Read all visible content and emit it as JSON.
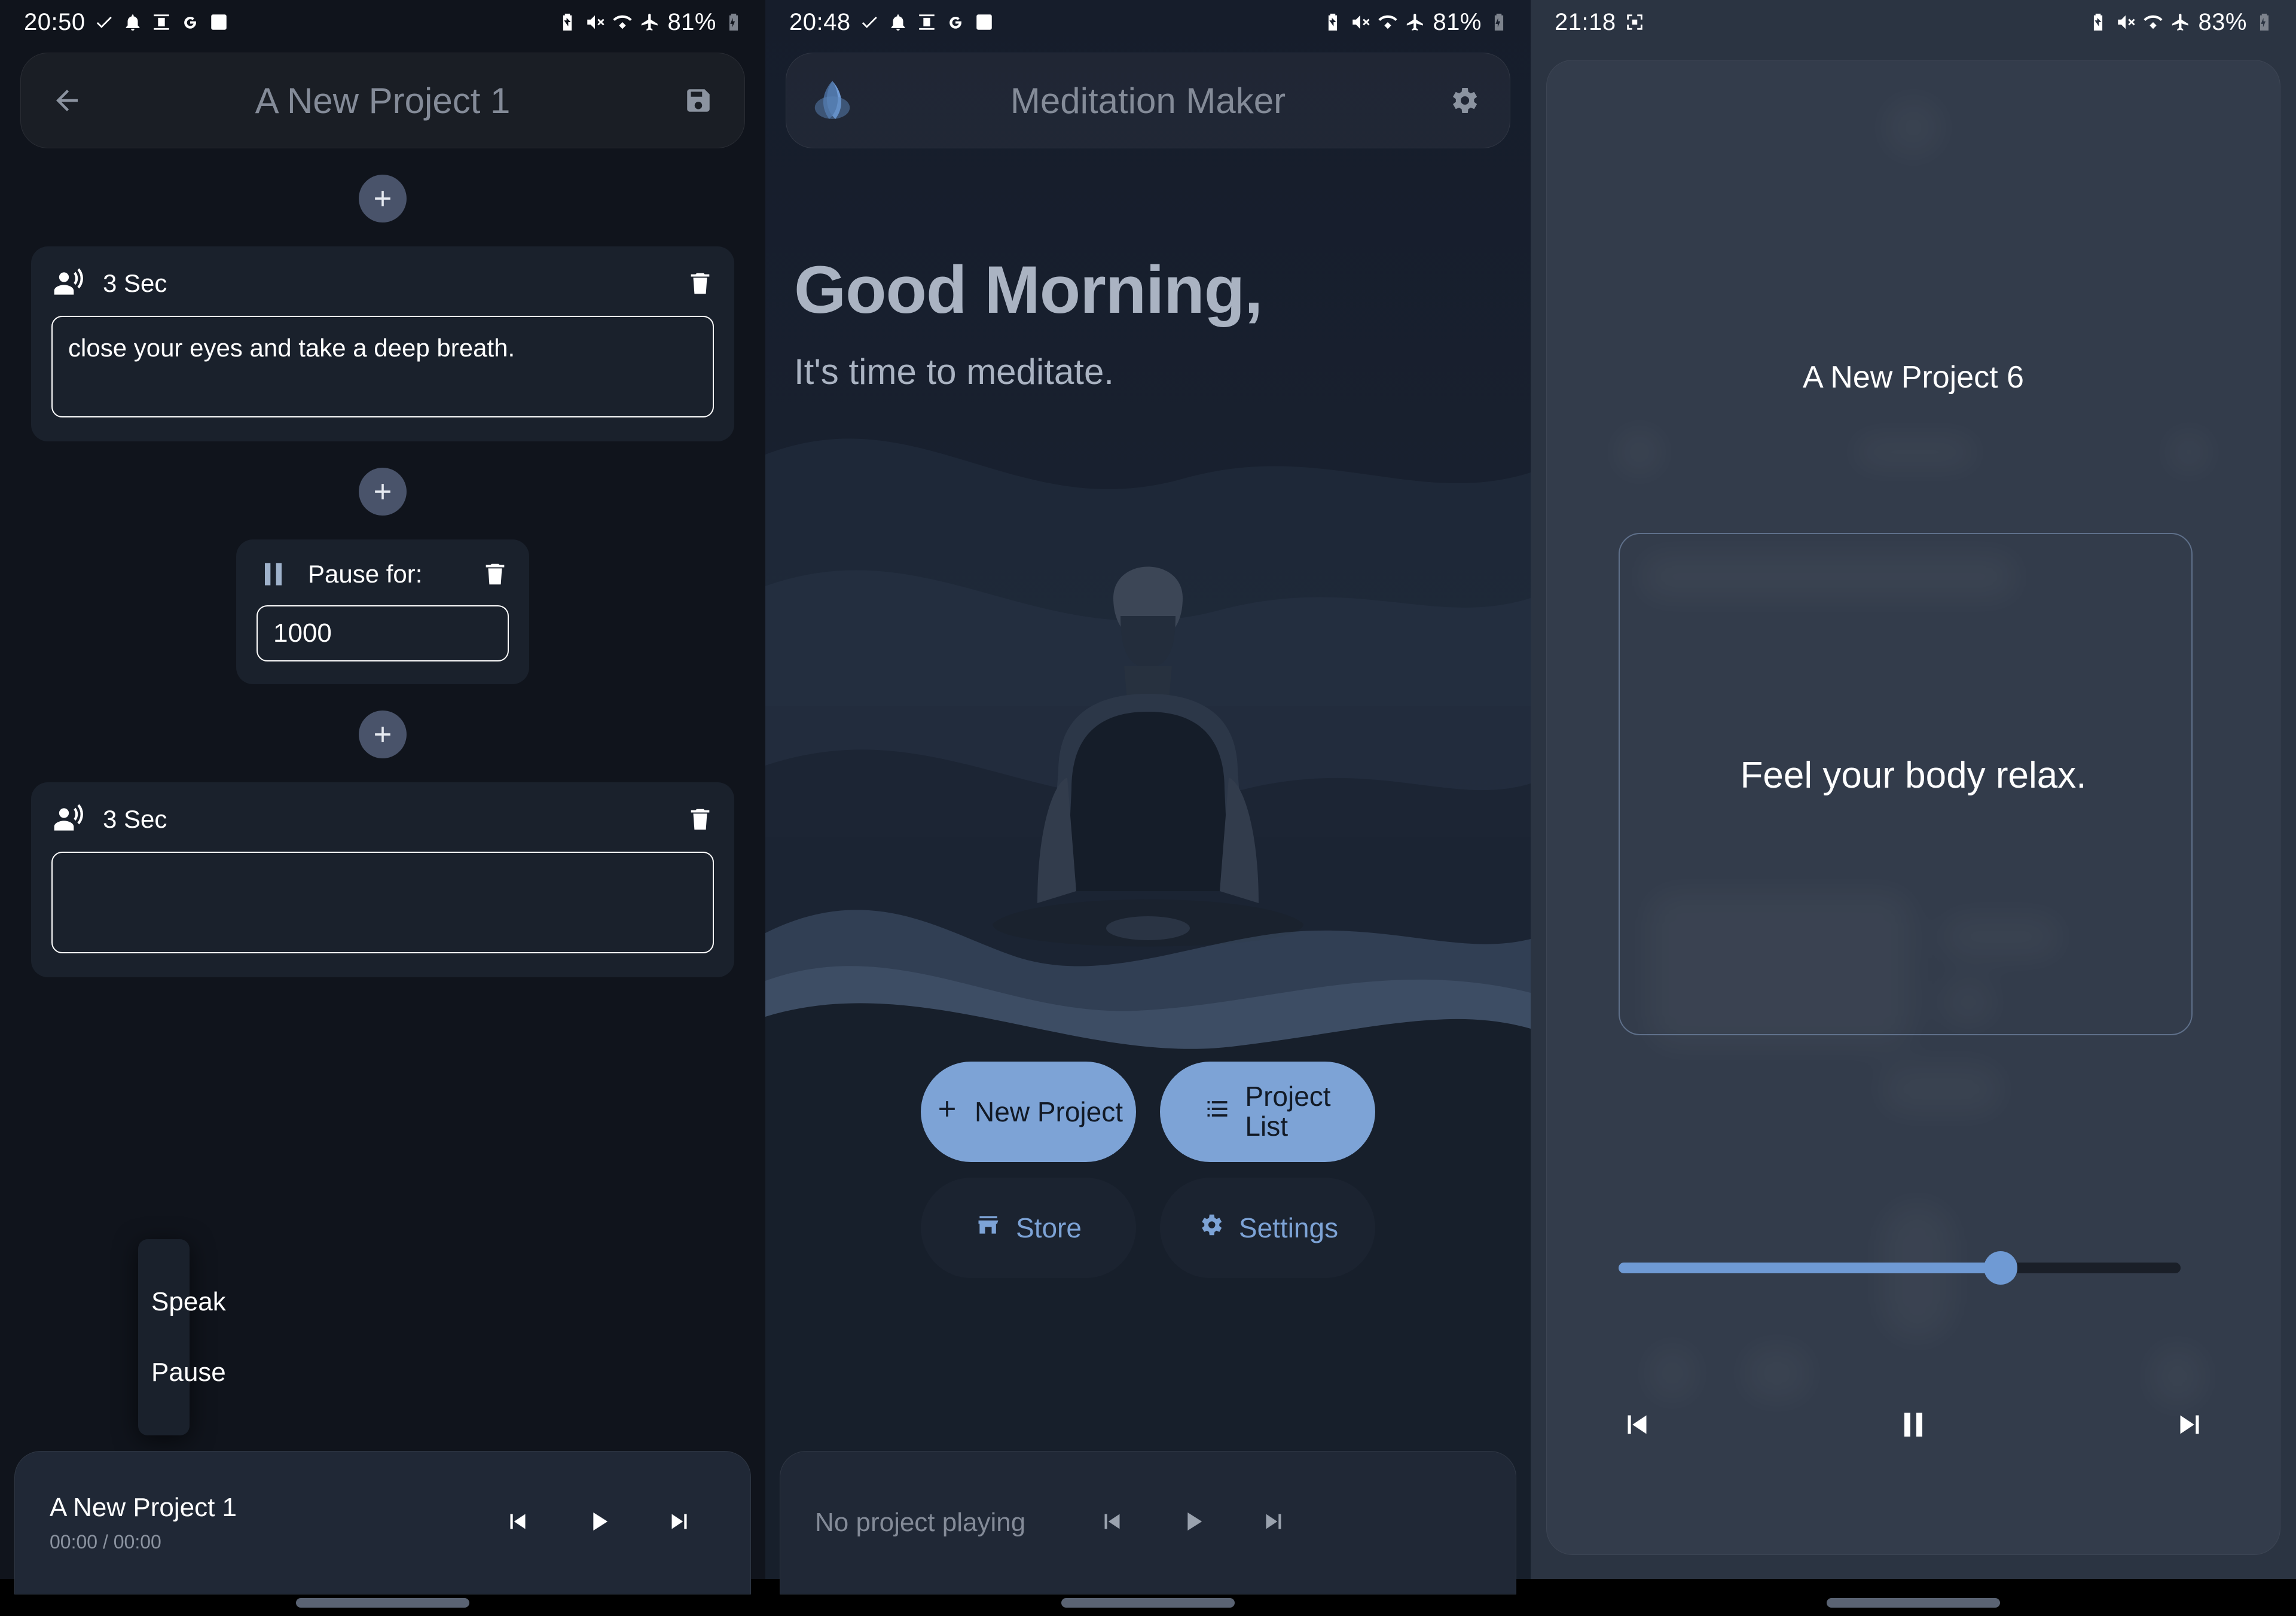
{
  "panels": {
    "left": {
      "statusbar": {
        "time": "20:50",
        "battery_pct": "81%",
        "icons_left": [
          "check-icon",
          "bell-icon",
          "vertical-align-icon",
          "google-icon",
          "image-icon"
        ],
        "icons_right": [
          "battery-saver-icon",
          "volume-off-icon",
          "wifi-icon",
          "airplane-icon",
          "battery-charging-icon"
        ]
      },
      "appbar": {
        "back_icon": "arrow-left-icon",
        "title": "A New Project 1",
        "save_icon": "save-icon"
      },
      "add_buttons": [
        "+",
        "+",
        "+"
      ],
      "steps": [
        {
          "type": "speak",
          "icon": "speaking-person-icon",
          "duration_label": "3 Sec",
          "delete_icon": "trash-icon",
          "text": "close your eyes and take a deep breath."
        },
        {
          "type": "pause",
          "icon": "pause-icon",
          "label": "Pause for:",
          "delete_icon": "trash-icon",
          "value": "1000"
        },
        {
          "type": "speak",
          "icon": "speaking-person-icon",
          "duration_label": "3 Sec",
          "delete_icon": "trash-icon",
          "text": ""
        }
      ],
      "context_menu": {
        "items": [
          "Speak",
          "Pause"
        ]
      },
      "player": {
        "title": "A New Project 1",
        "time": "00:00 / 00:00",
        "prev_icon": "skip-previous-icon",
        "play_icon": "play-icon",
        "next_icon": "skip-next-icon"
      }
    },
    "middle": {
      "statusbar": {
        "time": "20:48",
        "battery_pct": "81%"
      },
      "appbar": {
        "logo_icon": "meditation-maker-logo",
        "title": "Meditation Maker",
        "settings_icon": "gear-icon"
      },
      "greeting": {
        "headline": "Good Morning,",
        "subline": "It's time to meditate."
      },
      "buttons": [
        {
          "label": "New Project",
          "icon": "plus-icon",
          "style": "primary"
        },
        {
          "label": "Project\nList",
          "icon": "list-icon",
          "style": "primary"
        },
        {
          "label": "Store",
          "icon": "store-icon",
          "style": "secondary"
        },
        {
          "label": "Settings",
          "icon": "gear-icon",
          "style": "secondary"
        }
      ],
      "player": {
        "status": "No project playing",
        "prev_icon": "skip-previous-icon",
        "play_icon": "play-icon",
        "next_icon": "skip-next-icon"
      }
    },
    "right": {
      "statusbar": {
        "time": "21:18",
        "battery_pct": "83%",
        "icons_left": [
          "screenshot-icon"
        ]
      },
      "project_title": "A New Project 6",
      "phrase": "Feel your body relax.",
      "slider": {
        "value_pct": 68
      },
      "controls": {
        "prev_icon": "skip-previous-icon",
        "pause_icon": "pause-icon",
        "next_icon": "skip-next-icon"
      }
    }
  },
  "colors": {
    "accent": "#7da3d6",
    "card": "#1a212c",
    "bg_left": "#10141c",
    "bg_right": "#2b3442",
    "text_muted": "#848b98"
  }
}
